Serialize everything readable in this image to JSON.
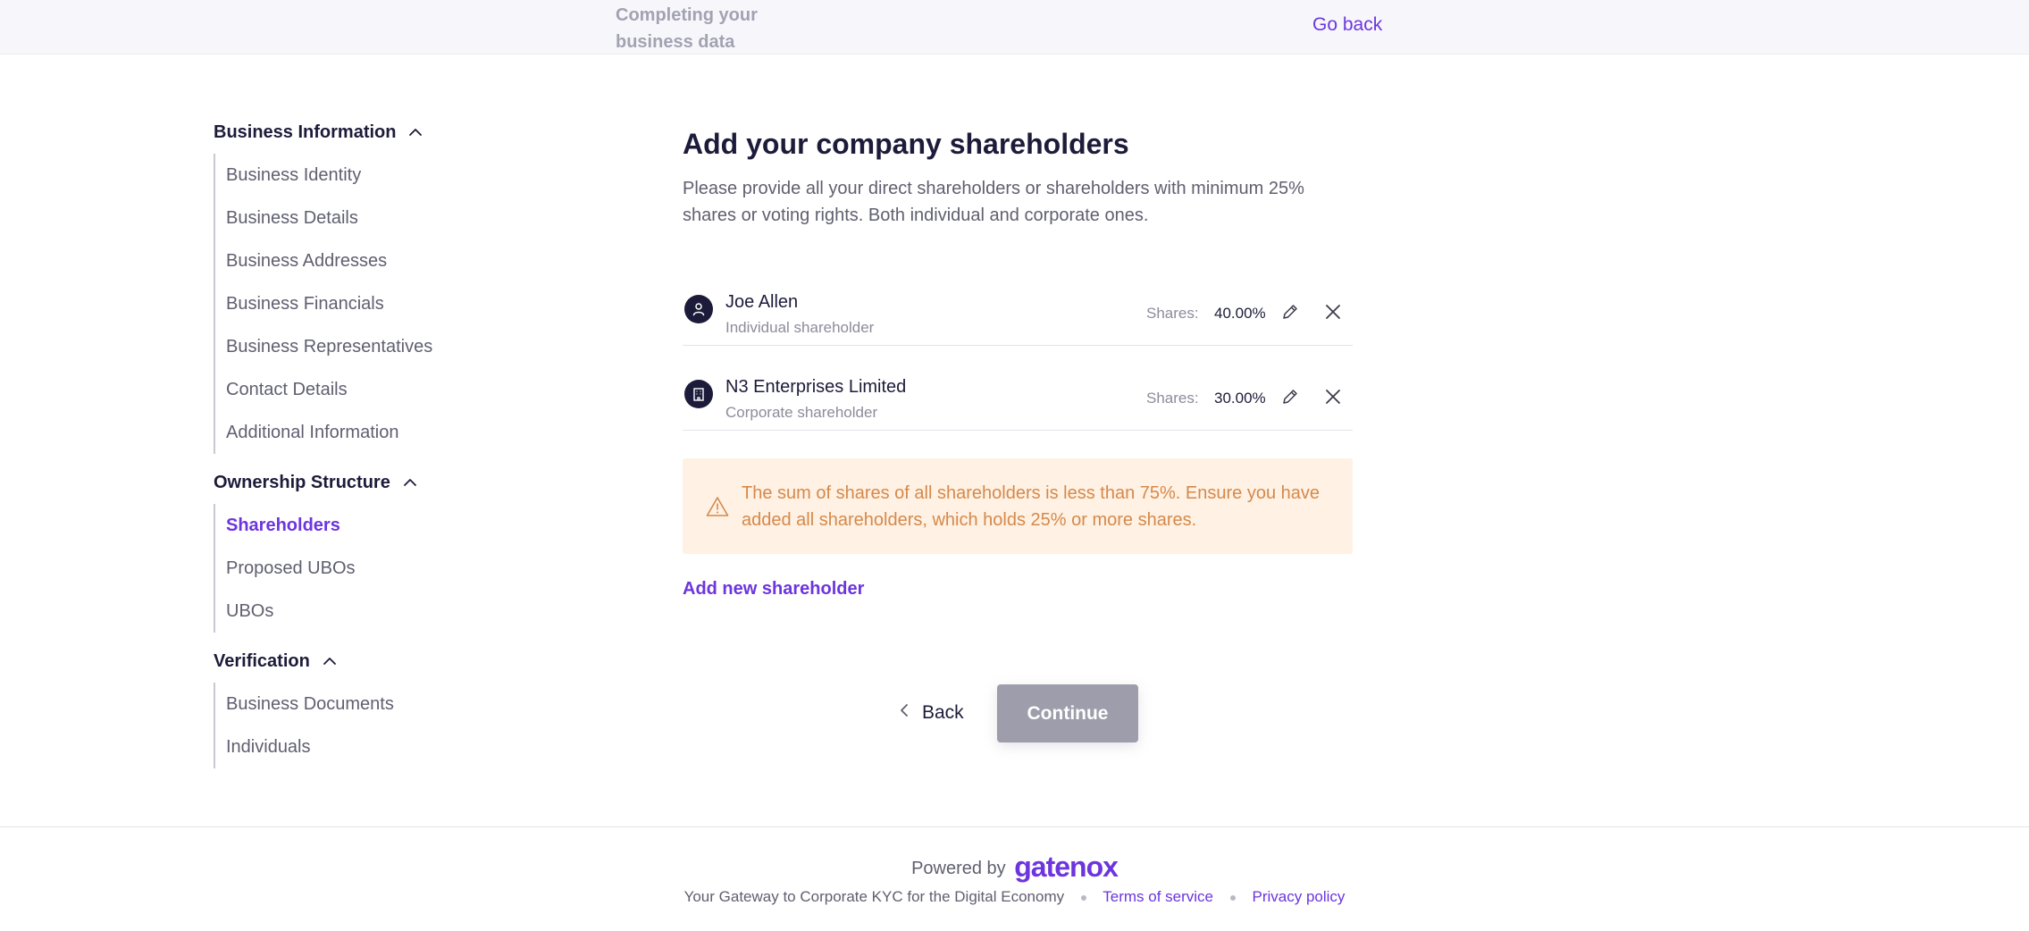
{
  "header": {
    "title": "Completing your business data",
    "go_back": "Go back"
  },
  "sidebar": {
    "sections": [
      {
        "title": "Business Information",
        "items": [
          "Business Identity",
          "Business Details",
          "Business Addresses",
          "Business Financials",
          "Business Representatives",
          "Contact Details",
          "Additional Information"
        ]
      },
      {
        "title": "Ownership Structure",
        "items": [
          "Shareholders",
          "Proposed UBOs",
          "UBOs"
        ]
      },
      {
        "title": "Verification",
        "items": [
          "Business Documents",
          "Individuals"
        ]
      }
    ],
    "active_item": "Shareholders"
  },
  "main": {
    "title": "Add your company shareholders",
    "description": "Please provide all your direct shareholders or shareholders with minimum 25% shares or voting rights. Both individual and corporate ones.",
    "shares_label": "Shares:",
    "shareholders": [
      {
        "name": "Joe Allen",
        "type": "Individual shareholder",
        "shares": "40.00%",
        "icon": "person-icon"
      },
      {
        "name": "N3 Enterprises Limited",
        "type": "Corporate shareholder",
        "shares": "30.00%",
        "icon": "building-icon"
      }
    ],
    "warning": "The sum of shares of all shareholders is less than 75%. Ensure you have added all shareholders, which holds 25% or more shares.",
    "add_new": "Add new shareholder",
    "back": "Back",
    "continue": "Continue"
  },
  "footer": {
    "powered_by": "Powered by",
    "brand": "gatenox",
    "tagline": "Your Gateway to Corporate KYC for the Digital Economy",
    "terms": "Terms of service",
    "privacy": "Privacy policy"
  },
  "colors": {
    "accent": "#6c35de",
    "warning_bg": "#fff1e3",
    "warning_text": "#d5894b",
    "button_disabled": "#9d9dab"
  }
}
